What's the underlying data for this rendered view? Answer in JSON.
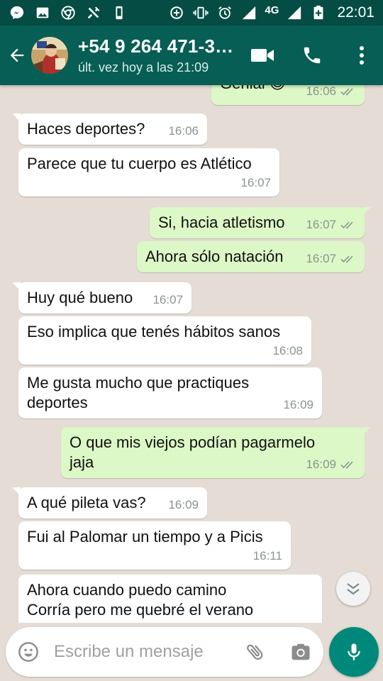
{
  "status_bar": {
    "left_icons": [
      "messenger-icon",
      "gallery-icon",
      "chrome-icon",
      "tools-icon",
      "phone-icon"
    ],
    "right_icons": [
      "data-saver-icon",
      "vibrate-icon",
      "alarm-icon",
      "signal-icon",
      "signal-4g-icon",
      "battery-charging-icon"
    ],
    "network": "4G",
    "time": "22:01"
  },
  "header": {
    "contact_name": "+54 9 264 471-3…",
    "last_seen": "últ. vez hoy a las 21:09",
    "actions": [
      "video-call-icon",
      "voice-call-icon",
      "more-options-icon"
    ]
  },
  "messages": [
    {
      "dir": "out",
      "text": "Genial 😊",
      "time": "16:06",
      "ticks": "double-check"
    },
    {
      "dir": "in",
      "text": "Haces deportes?",
      "time": "16:06"
    },
    {
      "dir": "in",
      "text": "Parece que tu cuerpo es Atlético",
      "time": "16:07"
    },
    {
      "dir": "out",
      "text": "Si, hacia atletismo",
      "time": "16:07",
      "ticks": "double-check"
    },
    {
      "dir": "out",
      "text": "Ahora sólo natación",
      "time": "16:07",
      "ticks": "double-check"
    },
    {
      "dir": "in",
      "text": "Huy qué bueno",
      "time": "16:07"
    },
    {
      "dir": "in",
      "text": "Eso implica que tenés hábitos sanos",
      "time": "16:08"
    },
    {
      "dir": "in",
      "text": "Me gusta mucho que practiques\ndeportes",
      "time": "16:09"
    },
    {
      "dir": "out",
      "text": "O que mis viejos podían pagarmelo\njaja",
      "time": "16:09",
      "ticks": "double-check"
    },
    {
      "dir": "in",
      "text": "A qué pileta vas?",
      "time": "16:09"
    },
    {
      "dir": "in",
      "text": "Fui al Palomar un tiempo y a Picis",
      "time": "16:11"
    },
    {
      "dir": "in",
      "text": "Ahora cuando puedo camino\nCorría pero me quebré el verano",
      "time": ""
    }
  ],
  "composer": {
    "placeholder": "Escribe un mensaje",
    "icons": [
      "emoji-icon",
      "attach-icon",
      "camera-icon",
      "mic-icon"
    ]
  },
  "colors": {
    "status_bar": "#054d44",
    "app_bar": "#075e54",
    "chat_background": "#e5ddd5",
    "incoming_bubble": "#ffffff",
    "outgoing_bubble": "#dcf8c6",
    "read_ticks": "#8a9491",
    "mic_button": "#00897b"
  }
}
